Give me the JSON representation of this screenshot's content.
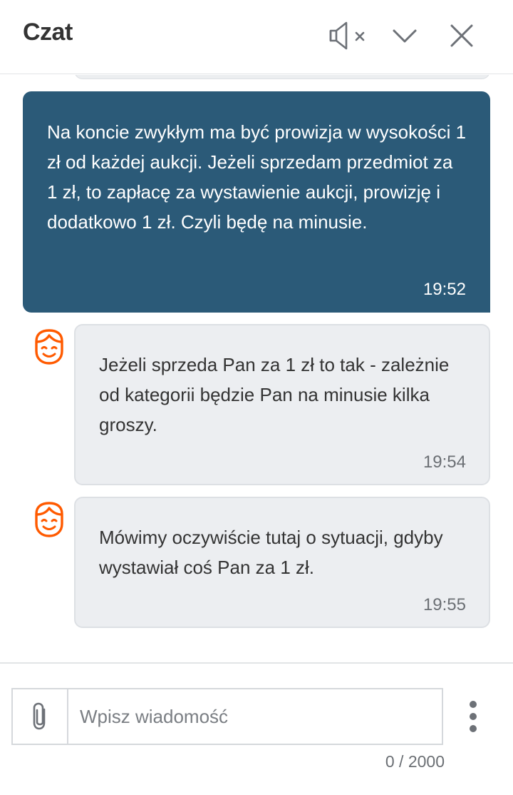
{
  "header": {
    "title": "Czat",
    "icons": {
      "mute": "speaker-muted-icon",
      "collapse": "chevron-down-icon",
      "close": "close-icon"
    }
  },
  "messages": [
    {
      "direction": "outgoing",
      "text": "Na koncie zwykłym ma być prowizja w wysokości 1 zł od każdej aukcji. Jeżeli sprzedam przedmiot za 1 zł, to zapłacę za wystawienie aukcji, prowizję i dodatkowo 1 zł. Czyli będę na minusie.",
      "time": "19:52"
    },
    {
      "direction": "incoming",
      "avatar": "agent-smile-icon",
      "text": "Jeżeli sprzeda Pan za 1 zł to tak - zależnie od kategorii będzie Pan na minusie kilka groszy.",
      "time": "19:54"
    },
    {
      "direction": "incoming",
      "avatar": "agent-smile-icon",
      "text": "Mówimy oczywiście tutaj o sytuacji, gdyby wystawiał coś Pan za 1 zł.",
      "time": "19:55"
    }
  ],
  "composer": {
    "placeholder": "Wpisz wiadomość",
    "value": "",
    "counter": "0 / 2000",
    "icons": {
      "attach": "paperclip-icon",
      "more": "more-vertical-icon"
    }
  },
  "colors": {
    "outgoing_bubble": "#2b5a78",
    "incoming_bubble": "#eceef1",
    "avatar_accent": "#ff5a00"
  }
}
